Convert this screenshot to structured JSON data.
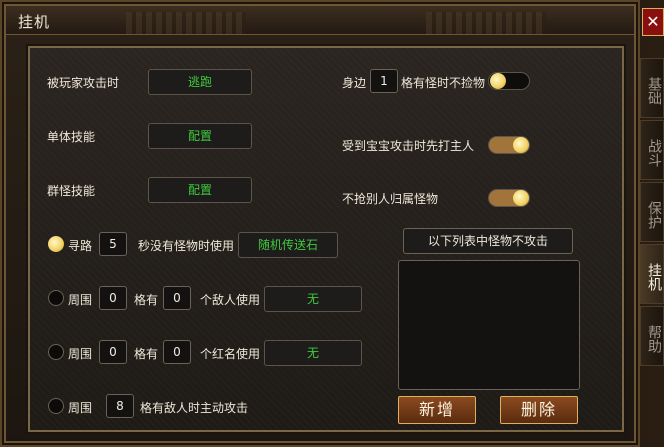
{
  "window": {
    "title": "挂机",
    "close_label": "✕"
  },
  "side_tabs": [
    "基础",
    "战斗",
    "保护",
    "挂机",
    "帮助"
  ],
  "left": {
    "attacked_by_player": {
      "label": "被玩家攻击时",
      "button": "逃跑"
    },
    "single_skill": {
      "label": "单体技能",
      "button": "配置"
    },
    "group_skill": {
      "label": "群怪技能",
      "button": "配置"
    },
    "pathfind": {
      "checked": true,
      "label": "寻路",
      "value": "5",
      "suffix": "秒没有怪物时使用",
      "button": "随机传送石"
    },
    "surround_enemy": {
      "checked": false,
      "label": "周围",
      "value1": "0",
      "mid": "格有",
      "value2": "0",
      "suffix": "个敌人使用",
      "button": "无"
    },
    "surround_red": {
      "checked": false,
      "label": "周围",
      "value1": "0",
      "mid": "格有",
      "value2": "0",
      "suffix": "个红名使用",
      "button": "无"
    },
    "auto_attack": {
      "checked": false,
      "label": "周围",
      "value": "8",
      "suffix": "格有敌人时主动攻击"
    }
  },
  "right": {
    "no_pickup": {
      "prefix": "身边",
      "value": "1",
      "suffix": "格有怪时不捡物",
      "on": false
    },
    "attack_owner_first": {
      "label": "受到宝宝攻击时先打主人",
      "on": true
    },
    "no_steal": {
      "label": "不抢别人归属怪物",
      "on": true
    },
    "exclude_list_title": "以下列表中怪物不攻击",
    "add_button": "新增",
    "delete_button": "删除"
  }
}
